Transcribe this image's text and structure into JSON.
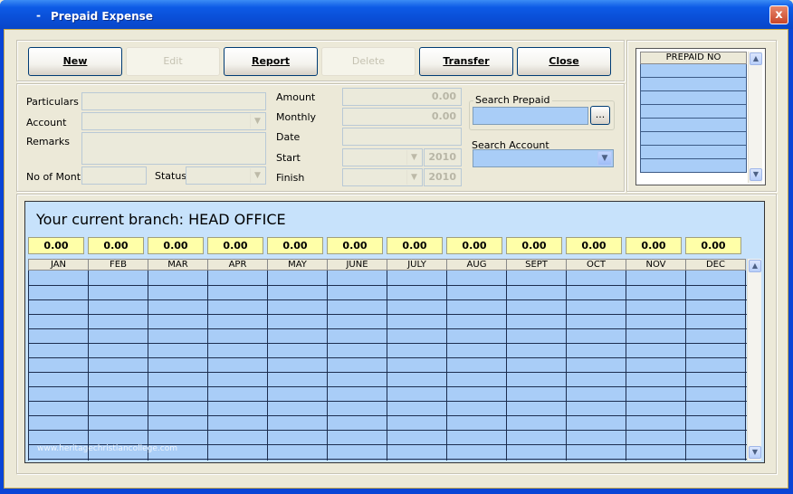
{
  "window": {
    "title": "Prepaid Expense",
    "title_prefix": "-",
    "close_glyph": "x"
  },
  "toolbar": {
    "new_label": "New",
    "edit_label": "Edit",
    "report_label": "Report",
    "delete_label": "Delete",
    "transfer_label": "Transfer",
    "close_label": "Close"
  },
  "form": {
    "particulars_label": "Particulars",
    "account_label": "Account",
    "remarks_label": "Remarks",
    "no_of_month_label": "No of Month",
    "status_label": "Status",
    "amount_label": "Amount",
    "amount_value": "0.00",
    "monthly_label": "Monthly",
    "monthly_value": "0.00",
    "date_label": "Date",
    "start_label": "Start",
    "start_year": "2010",
    "finish_label": "Finish",
    "finish_year": "2010"
  },
  "search": {
    "prepaid_label": "Search Prepaid",
    "browse_label": "...",
    "account_label": "Search Account"
  },
  "prepaid_list": {
    "header": "PREPAID NO"
  },
  "branch": {
    "text": "Your current branch: HEAD OFFICE",
    "watermark": "www.heritagechristiancollege.com"
  },
  "months": {
    "headers": [
      "JAN",
      "FEB",
      "MAR",
      "APR",
      "MAY",
      "JUNE",
      "JULY",
      "AUG",
      "SEPT",
      "OCT",
      "NOV",
      "DEC"
    ],
    "totals": [
      "0.00",
      "0.00",
      "0.00",
      "0.00",
      "0.00",
      "0.00",
      "0.00",
      "0.00",
      "0.00",
      "0.00",
      "0.00",
      "0.00"
    ]
  },
  "icons": {
    "dropdown": "chevron-down-icon",
    "scroll_up": "scroll-up-icon",
    "scroll_down": "scroll-down-icon"
  },
  "colors": {
    "title_bar": "#0a45d6",
    "grid_cell": "#a9cdf7",
    "total_cell": "#ffffa8",
    "panel_bg": "#c7e2fb"
  }
}
